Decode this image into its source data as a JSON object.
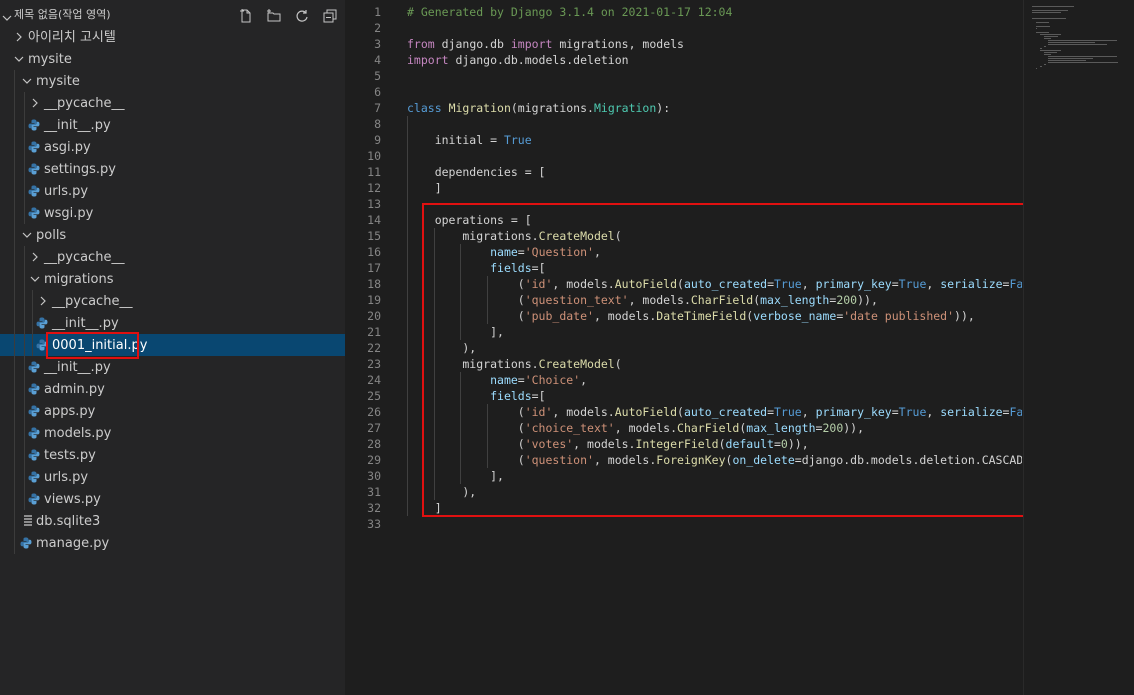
{
  "explorer": {
    "workspace_title": "제목 없음(작업 영역)",
    "tree": [
      {
        "label": "아이리치 고시텔",
        "type": "folder",
        "expanded": false
      },
      {
        "label": "mysite",
        "type": "folder",
        "expanded": true
      },
      {
        "label": "mysite",
        "type": "folder",
        "expanded": true
      },
      {
        "label": "__pycache__",
        "type": "folder",
        "expanded": false
      },
      {
        "label": "__init__.py",
        "type": "python"
      },
      {
        "label": "asgi.py",
        "type": "python"
      },
      {
        "label": "settings.py",
        "type": "python"
      },
      {
        "label": "urls.py",
        "type": "python"
      },
      {
        "label": "wsgi.py",
        "type": "python"
      },
      {
        "label": "polls",
        "type": "folder",
        "expanded": true
      },
      {
        "label": "__pycache__",
        "type": "folder",
        "expanded": false
      },
      {
        "label": "migrations",
        "type": "folder",
        "expanded": true
      },
      {
        "label": "__pycache__",
        "type": "folder",
        "expanded": false
      },
      {
        "label": "__init__.py",
        "type": "python"
      },
      {
        "label": "0001_initial.py",
        "type": "python",
        "selected": true
      },
      {
        "label": "__init__.py",
        "type": "python"
      },
      {
        "label": "admin.py",
        "type": "python"
      },
      {
        "label": "apps.py",
        "type": "python"
      },
      {
        "label": "models.py",
        "type": "python"
      },
      {
        "label": "tests.py",
        "type": "python"
      },
      {
        "label": "urls.py",
        "type": "python"
      },
      {
        "label": "views.py",
        "type": "python"
      },
      {
        "label": "db.sqlite3",
        "type": "db"
      },
      {
        "label": "manage.py",
        "type": "python"
      }
    ]
  },
  "editor": {
    "lines": [
      "# Generated by Django 3.1.4 on 2021-01-17 12:04",
      "",
      "from django.db import migrations, models",
      "import django.db.models.deletion",
      "",
      "",
      "class Migration(migrations.Migration):",
      "",
      "    initial = True",
      "",
      "    dependencies = [",
      "    ]",
      "",
      "    operations = [",
      "        migrations.CreateModel(",
      "            name='Question',",
      "            fields=[",
      "                ('id', models.AutoField(auto_created=True, primary_key=True, serialize=False,",
      "                ('question_text', models.CharField(max_length=200)),",
      "                ('pub_date', models.DateTimeField(verbose_name='date published')),",
      "            ],",
      "        ),",
      "        migrations.CreateModel(",
      "            name='Choice',",
      "            fields=[",
      "                ('id', models.AutoField(auto_created=True, primary_key=True, serialize=False,",
      "                ('choice_text', models.CharField(max_length=200)),",
      "                ('votes', models.IntegerField(default=0)),",
      "                ('question', models.ForeignKey(on_delete=django.db.models.deletion.CASCADE, to",
      "            ],",
      "        ),",
      "    ]",
      ""
    ]
  },
  "colors": {
    "sidebar_bg": "#252526",
    "editor_bg": "#1e1e1e",
    "selected_row": "#094771",
    "highlight_box": "#e01010",
    "python_icon": "#3572a5"
  }
}
